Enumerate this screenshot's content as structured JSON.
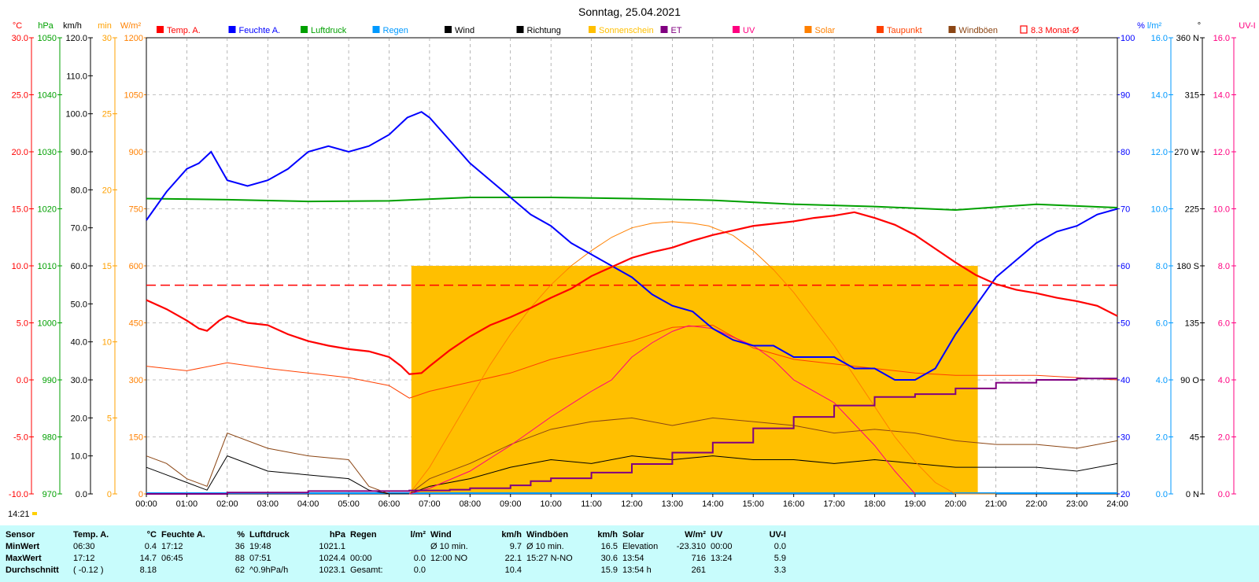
{
  "chart_data": {
    "type": "line",
    "title": "Sonntag, 25.04.2021",
    "time_label": "14:21",
    "x_ticks": [
      "00:00",
      "01:00",
      "02:00",
      "03:00",
      "04:00",
      "05:00",
      "06:00",
      "07:00",
      "08:00",
      "09:00",
      "10:00",
      "11:00",
      "12:00",
      "13:00",
      "14:00",
      "15:00",
      "16:00",
      "17:00",
      "18:00",
      "19:00",
      "20:00",
      "21:00",
      "22:00",
      "23:00",
      "24:00"
    ],
    "legend": [
      {
        "name": "Temp. A.",
        "color": "#ff0000"
      },
      {
        "name": "Feuchte A.",
        "color": "#0000ff"
      },
      {
        "name": "Luftdruck",
        "color": "#00a000"
      },
      {
        "name": "Regen",
        "color": "#0099ff"
      },
      {
        "name": "Wind",
        "color": "#000000"
      },
      {
        "name": "Richtung",
        "color": "#000000"
      },
      {
        "name": "Sonnenschein",
        "color": "#ffbf00"
      },
      {
        "name": "ET",
        "color": "#800080"
      },
      {
        "name": "UV",
        "color": "#ff0080"
      },
      {
        "name": "Solar",
        "color": "#ff8000"
      },
      {
        "name": "Taupunkt",
        "color": "#ff4000"
      },
      {
        "name": "Windböen",
        "color": "#8b4513"
      },
      {
        "name": "8.3 Monat-Ø",
        "color": "#ff0000"
      }
    ],
    "axes": {
      "temp": {
        "unit": "°C",
        "color": "#ff0000",
        "range": [
          -10,
          30
        ],
        "ticks": [
          "30.0",
          "25.0",
          "20.0",
          "15.0",
          "10.0",
          "5.0",
          "0.0",
          "-5.0",
          "-10.0"
        ]
      },
      "pressure": {
        "unit": "hPa",
        "color": "#00a000",
        "range": [
          970,
          1050
        ],
        "ticks": [
          "1050",
          "1040",
          "1030",
          "1020",
          "1010",
          "1000",
          "990",
          "980",
          "970"
        ]
      },
      "wind": {
        "unit": "km/h",
        "color": "#000000",
        "range": [
          0,
          120
        ],
        "ticks": [
          "120.0",
          "110.0",
          "100.0",
          "90.0",
          "80.0",
          "70.0",
          "60.0",
          "50.0",
          "40.0",
          "30.0",
          "20.0",
          "10.0",
          "0.0"
        ]
      },
      "sunshine": {
        "unit": "min",
        "color": "#ffa000",
        "range": [
          0,
          30
        ],
        "ticks": [
          "30",
          "25",
          "20",
          "15",
          "10",
          "5",
          "0"
        ]
      },
      "solar": {
        "unit": "W/m²",
        "color": "#ff8000",
        "range": [
          0,
          1200
        ],
        "ticks": [
          "1200",
          "1050",
          "900",
          "750",
          "600",
          "450",
          "300",
          "150",
          "0"
        ]
      },
      "humidity": {
        "unit": "%",
        "color": "#0000ff",
        "range": [
          20,
          100
        ],
        "ticks": [
          "100",
          "90",
          "80",
          "70",
          "60",
          "50",
          "40",
          "30",
          "20"
        ]
      },
      "rain": {
        "unit": "l/m²",
        "color": "#0099ff",
        "range": [
          0,
          16
        ],
        "ticks": [
          "16.0",
          "14.0",
          "12.0",
          "10.0",
          "8.0",
          "6.0",
          "4.0",
          "2.0",
          "0.0"
        ]
      },
      "direction": {
        "unit": "°",
        "color": "#000000",
        "range": [
          0,
          360
        ],
        "ticks": [
          "360 N",
          "315",
          "270 W",
          "225",
          "180 S",
          "135",
          "90 O",
          "45",
          "0 N"
        ]
      },
      "uvi": {
        "unit": "UV-I",
        "color": "#ff0080",
        "range": [
          0,
          16
        ],
        "ticks": [
          "16.0",
          "14.0",
          "12.0",
          "10.0",
          "8.0",
          "6.0",
          "4.0",
          "2.0",
          "0.0"
        ]
      }
    },
    "monthly_avg_temp": 8.3,
    "series": [
      {
        "name": "Temp. A.",
        "unit": "°C",
        "x": [
          0,
          0.5,
          1,
          1.3,
          1.5,
          1.8,
          2,
          2.5,
          3,
          3.5,
          4,
          4.5,
          5,
          5.5,
          6,
          6.3,
          6.5,
          6.8,
          7,
          7.5,
          8,
          8.5,
          9,
          9.5,
          10,
          10.5,
          11,
          11.5,
          12,
          12.5,
          13,
          13.5,
          14,
          14.5,
          15,
          15.5,
          16,
          16.5,
          17,
          17.5,
          18,
          18.5,
          19,
          19.5,
          20,
          20.5,
          21,
          21.5,
          22,
          22.5,
          23,
          23.5,
          24
        ],
        "y": [
          7.0,
          6.2,
          5.2,
          4.5,
          4.3,
          5.2,
          5.6,
          5.0,
          4.8,
          4.0,
          3.4,
          3.0,
          2.7,
          2.5,
          2.0,
          1.2,
          0.5,
          0.6,
          1.2,
          2.6,
          3.8,
          4.8,
          5.5,
          6.3,
          7.2,
          8.0,
          9.1,
          9.9,
          10.7,
          11.2,
          11.6,
          12.2,
          12.7,
          13.1,
          13.5,
          13.7,
          13.9,
          14.2,
          14.4,
          14.7,
          14.2,
          13.6,
          12.7,
          11.5,
          10.3,
          9.2,
          8.4,
          7.9,
          7.6,
          7.2,
          6.9,
          6.5,
          5.6
        ]
      },
      {
        "name": "Feuchte A.",
        "unit": "%",
        "x": [
          0,
          0.5,
          1,
          1.3,
          1.6,
          2,
          2.5,
          3,
          3.5,
          4,
          4.5,
          5,
          5.5,
          6,
          6.45,
          6.8,
          7,
          7.5,
          8,
          8.5,
          9,
          9.5,
          10,
          10.5,
          11,
          11.5,
          12,
          12.5,
          13,
          13.5,
          14,
          14.5,
          15,
          15.5,
          16,
          16.5,
          17,
          17.5,
          18,
          18.5,
          19,
          19.5,
          20,
          20.5,
          21,
          21.5,
          22,
          22.5,
          23,
          23.5,
          24
        ],
        "y": [
          68,
          73,
          77,
          78,
          80,
          75,
          74,
          75,
          77,
          80,
          81,
          80,
          81,
          83,
          86,
          87,
          86,
          82,
          78,
          75,
          72,
          69,
          67,
          64,
          62,
          60,
          58,
          55,
          53,
          52,
          49,
          47,
          46,
          46,
          44,
          44,
          44,
          42,
          42,
          40,
          40,
          42,
          48,
          53,
          58,
          61,
          64,
          66,
          67,
          69,
          70
        ]
      },
      {
        "name": "Luftdruck",
        "unit": "hPa",
        "x": [
          0,
          2,
          4,
          6,
          8,
          10,
          12,
          14,
          16,
          18,
          20,
          22,
          24
        ],
        "y": [
          1021.8,
          1021.6,
          1021.3,
          1021.4,
          1022.0,
          1022.0,
          1021.8,
          1021.5,
          1020.8,
          1020.4,
          1019.8,
          1020.8,
          1020.2
        ]
      },
      {
        "name": "Solar",
        "unit": "W/m²",
        "x": [
          6.5,
          7,
          7.5,
          8,
          8.5,
          9,
          9.5,
          10,
          10.5,
          11,
          11.5,
          12,
          12.5,
          13,
          13.5,
          13.9,
          14.5,
          15,
          15.5,
          16,
          16.5,
          17,
          17.5,
          18,
          18.5,
          19,
          19.5,
          20,
          20.5,
          21
        ],
        "y": [
          0,
          70,
          160,
          250,
          340,
          420,
          490,
          550,
          600,
          640,
          675,
          700,
          712,
          716,
          712,
          705,
          680,
          640,
          590,
          530,
          460,
          390,
          310,
          230,
          150,
          85,
          30,
          0,
          0,
          0
        ]
      },
      {
        "name": "UV",
        "unit": "UV-I",
        "x": [
          6.5,
          7,
          8,
          9,
          10,
          11,
          11.5,
          12,
          12.5,
          13,
          13.4,
          14,
          14.5,
          15,
          15.5,
          16,
          17,
          18,
          18.5,
          19
        ],
        "y": [
          0,
          0.2,
          0.8,
          1.7,
          2.7,
          3.6,
          4.0,
          4.8,
          5.3,
          5.7,
          5.9,
          5.8,
          5.5,
          5.2,
          4.7,
          4.0,
          3.2,
          1.7,
          0.8,
          0.0
        ]
      },
      {
        "name": "ET",
        "unit": "l/m²",
        "x": [
          0,
          1,
          2,
          3,
          4,
          5,
          6,
          6.5,
          7,
          7.5,
          8,
          9,
          9.5,
          10,
          11,
          12,
          13,
          14,
          15,
          16,
          17,
          18,
          19,
          20,
          21,
          22,
          23,
          24
        ],
        "y": [
          0,
          0,
          0.05,
          0.05,
          0.1,
          0.1,
          0.1,
          0.12,
          0.12,
          0.15,
          0.2,
          0.3,
          0.45,
          0.55,
          0.75,
          1.05,
          1.45,
          1.8,
          2.3,
          2.7,
          3.1,
          3.4,
          3.5,
          3.7,
          3.9,
          4.0,
          4.05,
          4.05
        ]
      },
      {
        "name": "Sonnenschein",
        "unit": "min",
        "x": [
          6.55,
          20.55
        ],
        "y": [
          15,
          15
        ]
      },
      {
        "name": "Taupunkt",
        "unit": "°C",
        "x": [
          0,
          1,
          2,
          3,
          4,
          5,
          6,
          6.5,
          7,
          8,
          9,
          10,
          11,
          12,
          13,
          14,
          15,
          16,
          17,
          18,
          19,
          20,
          21,
          22,
          23,
          24
        ],
        "y": [
          1.2,
          0.8,
          1.5,
          1.0,
          0.6,
          0.2,
          -0.5,
          -1.6,
          -1.0,
          -0.2,
          0.6,
          1.8,
          2.6,
          3.4,
          4.6,
          4.8,
          2.8,
          1.8,
          1.4,
          1.0,
          0.6,
          0.4,
          0.4,
          0.4,
          0.2,
          0.0
        ]
      },
      {
        "name": "Wind",
        "unit": "km/h",
        "x": [
          0,
          0.5,
          1,
          1.5,
          2,
          3,
          4,
          5,
          5.5,
          6,
          6.5,
          7,
          8,
          9,
          10,
          11,
          12,
          13,
          14,
          15,
          16,
          17,
          18,
          19,
          20,
          21,
          22,
          23,
          24
        ],
        "y": [
          7,
          5,
          3,
          1,
          10,
          6,
          5,
          4,
          1,
          0,
          0,
          2,
          4,
          7,
          9,
          8,
          10,
          9,
          10,
          9,
          9,
          8,
          9,
          8,
          7,
          7,
          7,
          6,
          8
        ]
      },
      {
        "name": "Windböen",
        "unit": "km/h",
        "x": [
          0,
          0.5,
          1,
          1.5,
          2,
          3,
          4,
          5,
          5.5,
          6,
          6.5,
          7,
          8,
          9,
          10,
          11,
          12,
          13,
          14,
          15,
          16,
          17,
          18,
          19,
          20,
          21,
          22,
          23,
          24
        ],
        "y": [
          10,
          8,
          4,
          2,
          16,
          12,
          10,
          9,
          2,
          0,
          0,
          4,
          8,
          13,
          17,
          19,
          20,
          18,
          20,
          19,
          18,
          16,
          17,
          16,
          14,
          13,
          13,
          12,
          14
        ]
      }
    ]
  },
  "table": {
    "headers": [
      "Sensor",
      "Temp. A.",
      "°C",
      "Feuchte A.",
      "%",
      "Luftdruck",
      "hPa",
      "Regen",
      "l/m²",
      "Wind",
      "km/h",
      "Windböen",
      "km/h",
      "Solar",
      "W/m²",
      "UV",
      "UV-I"
    ],
    "rows": [
      {
        "label": "MinWert",
        "cells": [
          "06:30",
          "0.4",
          "17:12",
          "36",
          "19:48",
          "1021.1",
          "",
          "",
          "Ø 10 min.",
          "9.7",
          "Ø 10 min.",
          "16.5",
          "Elevation",
          "-23.310",
          "00:00",
          "0.0"
        ]
      },
      {
        "label": "MaxWert",
        "cells": [
          "17:12",
          "14.7",
          "06:45",
          "88",
          "07:51",
          "1024.4",
          "00:00",
          "0.0",
          "12:00   NO",
          "22.1",
          "15:27   N-NO",
          "30.6",
          "13:54",
          "716",
          "13:24",
          "5.9"
        ]
      },
      {
        "label": "Durchschnitt",
        "cells": [
          "( -0.12 )",
          "8.18",
          "",
          "62",
          "^0.9hPa/h",
          "1023.1",
          "Gesamt:",
          "0.0",
          "",
          "10.4",
          "",
          "15.9",
          "13:54 h",
          "261",
          "",
          "3.3"
        ]
      }
    ]
  }
}
